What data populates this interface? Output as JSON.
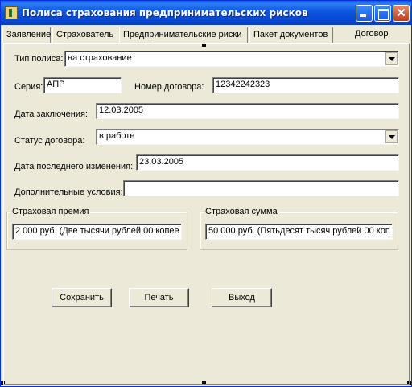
{
  "window": {
    "title": "Полиса страхования предпринимательских рисков",
    "close_glyph": "✕"
  },
  "tabs": [
    {
      "label": "Заявление"
    },
    {
      "label": "Страхователь"
    },
    {
      "label": "Предпринимательские риски"
    },
    {
      "label": "Пакет документов"
    },
    {
      "label": "Договор"
    }
  ],
  "active_tab": "Договор",
  "form": {
    "policy_type_label": "Тип полиса:",
    "policy_type_value": "на страхование",
    "series_label": "Серия:",
    "series_value": "АПР",
    "contract_number_label": "Номер договора:",
    "contract_number_value": "12342242323",
    "conclusion_date_label": "Дата заключения:",
    "conclusion_date_value": "12.03.2005",
    "status_label": "Статус договора:",
    "status_value": "в работе",
    "last_change_label": "Дата последнего изменения:",
    "last_change_value": "23.03.2005",
    "extra_terms_label": "Дополнительные условия:",
    "extra_terms_value": ""
  },
  "premium": {
    "label": "Страховая премия",
    "value": "2 000 руб. (Две тысячи рублей 00 копее"
  },
  "sum_insured": {
    "label": "Страховая сумма",
    "value": "50 000 руб. (Пятьдесят тысяч рублей 00 коп"
  },
  "buttons": {
    "save": "Сохранить",
    "print": "Печать",
    "exit": "Выход"
  },
  "colors": {
    "titlebar": "#0a55df",
    "face": "#ece9d8",
    "close_button": "#c2391a"
  }
}
